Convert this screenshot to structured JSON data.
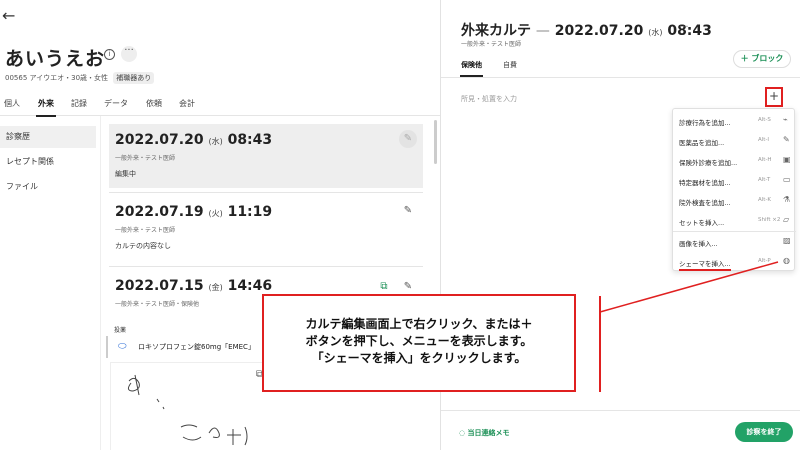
{
  "nav": {
    "back_icon": "arrow-left-icon"
  },
  "patient": {
    "name": "あいうえお",
    "meta": "00565 アイウエオ・30歳・女性",
    "badge": "補職器あり"
  },
  "left_tabs": [
    "個人",
    "外来",
    "記録",
    "データ",
    "依頼",
    "会計"
  ],
  "left_tab_active": "外来",
  "subnav": [
    "診察歴",
    "レセプト関係",
    "ファイル"
  ],
  "subnav_active": "診察歴",
  "entries": [
    {
      "date": "2022.07.20",
      "dow": "(水)",
      "time": "08:43",
      "sub": "一般外来・テスト医師",
      "note": "編集中",
      "selected": true
    },
    {
      "date": "2022.07.19",
      "dow": "(火)",
      "time": "11:19",
      "sub": "一般外来・テスト医師",
      "note": "カルテの内容なし",
      "selected": false
    },
    {
      "date": "2022.07.15",
      "dow": "(金)",
      "time": "14:46",
      "sub": "一般外来・テスト医師・保険他",
      "note": "",
      "selected": false
    }
  ],
  "prescription": {
    "label": "投薬",
    "item": "ロキソプロフェン錠60mg「EMEC」"
  },
  "record": {
    "title_prefix": "外来カルテ",
    "dash": "—",
    "date": "2022.07.20",
    "dow": "(水)",
    "time": "08:43",
    "sub": "一般外来・テスト医師",
    "block_button": "＋ ブロック",
    "tabs": [
      "保険他",
      "自費"
    ],
    "tab_active": "保険他",
    "placeholder": "所見・処置を入力",
    "plus": "+"
  },
  "menu": {
    "items": [
      {
        "label": "診療行為を追加...",
        "shortcut": "Alt-S",
        "icon": "syringe-icon",
        "glyph": "⌁"
      },
      {
        "label": "医薬品を追加...",
        "shortcut": "Alt-I",
        "icon": "pill-icon",
        "glyph": "✎"
      },
      {
        "label": "保険外診療を追加...",
        "shortcut": "Alt-H",
        "icon": "clipboard-icon",
        "glyph": "▣"
      },
      {
        "label": "特定器材を追加...",
        "shortcut": "Alt-T",
        "icon": "chat-icon",
        "glyph": "▭"
      },
      {
        "label": "院外検査を追加...",
        "shortcut": "Alt-K",
        "icon": "flask-icon",
        "glyph": "⚗"
      },
      {
        "label": "セットを挿入...",
        "shortcut": "Shift ×2",
        "icon": "folder-icon",
        "glyph": "▱"
      },
      {
        "label": "画像を挿入...",
        "shortcut": "",
        "icon": "image-icon",
        "glyph": "▨"
      },
      {
        "label": "シェーマを挿入...",
        "shortcut": "Alt-P",
        "icon": "palette-icon",
        "glyph": "◍"
      }
    ]
  },
  "footer": {
    "contact": "当日連絡メモ",
    "finish": "診察を終了"
  },
  "annotation": {
    "text": "カルテ編集画面上で右クリック、または＋\nボタンを押下し、メニューを表示します。\n「シェーマを挿入」をクリックします。"
  },
  "colors": {
    "accent_green": "#22a267",
    "annotation_red": "#e02020",
    "selected_bg": "#eeeeee"
  }
}
